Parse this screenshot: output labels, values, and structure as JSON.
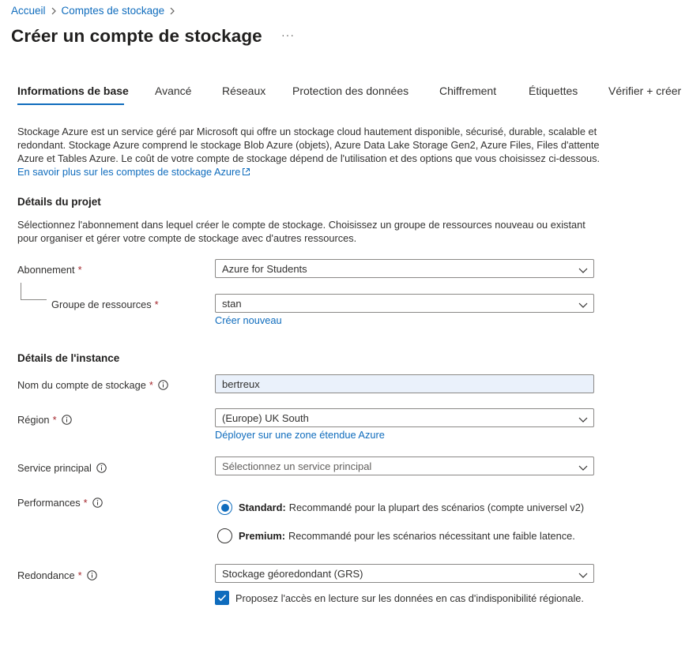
{
  "breadcrumb": {
    "items": [
      "Accueil",
      "Comptes de stockage"
    ]
  },
  "page": {
    "title": "Créer un compte de stockage",
    "more": "···"
  },
  "tabs": [
    {
      "label": "Informations de base",
      "active": true
    },
    {
      "label": "Avancé"
    },
    {
      "label": "Réseaux"
    },
    {
      "label": "Protection des données"
    },
    {
      "label": "Chiffrement"
    },
    {
      "label": "Étiquettes"
    },
    {
      "label": "Vérifier + créer"
    }
  ],
  "intro": {
    "text": "Stockage Azure est un service géré par Microsoft qui offre un stockage cloud hautement disponible, sécurisé, durable, scalable et redondant. Stockage Azure comprend le stockage Blob Azure (objets), Azure Data Lake Storage Gen2, Azure Files, Files d'attente Azure et Tables Azure. Le coût de votre compte de stockage dépend de l'utilisation et des options que vous choisissez ci-dessous.",
    "link": "En savoir plus sur les comptes de stockage Azure"
  },
  "project": {
    "title": "Détails du projet",
    "description": "Sélectionnez l'abonnement dans lequel créer le compte de stockage. Choisissez un groupe de ressources nouveau ou existant pour organiser et gérer votre compte de stockage avec d'autres ressources.",
    "subscription": {
      "label": "Abonnement",
      "value": "Azure for Students"
    },
    "resource_group": {
      "label": "Groupe de ressources",
      "value": "stan",
      "create_new": "Créer nouveau"
    }
  },
  "instance": {
    "title": "Détails de l'instance",
    "account_name": {
      "label": "Nom du compte de stockage",
      "value": "bertreux"
    },
    "region": {
      "label": "Région",
      "value": "(Europe) UK South",
      "link": "Déployer sur une zone étendue Azure"
    },
    "service": {
      "label": "Service principal",
      "placeholder": "Sélectionnez un service principal"
    },
    "performance": {
      "label": "Performances",
      "options": [
        {
          "name": "Standard:",
          "desc": "Recommandé pour la plupart des scénarios (compte universel v2)",
          "selected": true
        },
        {
          "name": "Premium:",
          "desc": "Recommandé pour les scénarios nécessitant une faible latence.",
          "selected": false
        }
      ]
    },
    "redundancy": {
      "label": "Redondance",
      "value": "Stockage géoredondant (GRS)",
      "checkbox": "Proposez l'accès en lecture sur les données en cas d'indisponibilité régionale.",
      "checked": true
    }
  },
  "required_mark": "*",
  "colors": {
    "accent": "#0f6cbd",
    "required": "#a4262c",
    "textbox_bg": "#eaf1fb"
  }
}
